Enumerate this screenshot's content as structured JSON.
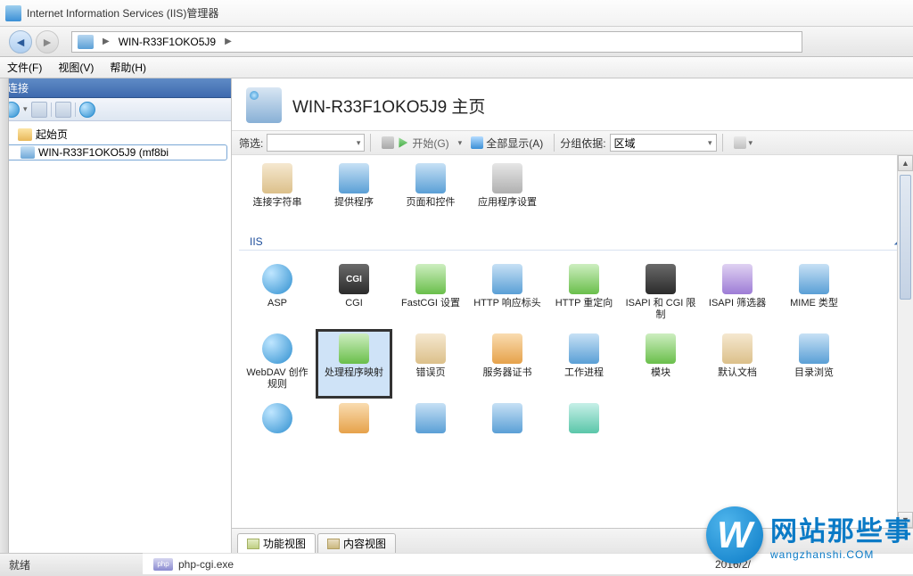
{
  "titlebar": {
    "title": "Internet Information Services (IIS)管理器"
  },
  "breadcrumb": {
    "server": "WIN-R33F1OKO5J9"
  },
  "menu": {
    "file": "文件(F)",
    "view": "视图(V)",
    "help": "帮助(H)"
  },
  "leftpanel": {
    "header": "连接",
    "items": [
      {
        "label": "起始页",
        "icon": "home"
      },
      {
        "label": "WIN-R33F1OKO5J9 (mf8bi",
        "icon": "server",
        "selected": true
      }
    ]
  },
  "content": {
    "title": "WIN-R33F1OKO5J9 主页",
    "filter": {
      "label": "筛选:",
      "value": "",
      "go": "开始(G)",
      "showAll": "全部显示(A)",
      "groupByLabel": "分组依据:",
      "groupByValue": "区域"
    },
    "groupTop": {
      "items": [
        {
          "name": "connection-strings",
          "label": "连接字符串",
          "cls": "c-tan"
        },
        {
          "name": "providers",
          "label": "提供程序",
          "cls": "c-blue"
        },
        {
          "name": "pages-controls",
          "label": "页面和控件",
          "cls": "c-blue"
        },
        {
          "name": "app-settings",
          "label": "应用程序设置",
          "cls": "c-gray"
        }
      ]
    },
    "groupIIS": {
      "header": "IIS",
      "items": [
        {
          "name": "asp",
          "label": "ASP",
          "cls": "c-globe"
        },
        {
          "name": "cgi",
          "label": "CGI",
          "cls": "c-dark cgi-txt",
          "text": "CGI"
        },
        {
          "name": "fastcgi",
          "label": "FastCGI 设置",
          "cls": "c-green"
        },
        {
          "name": "http-response-headers",
          "label": "HTTP 响应标头",
          "cls": "c-blue"
        },
        {
          "name": "http-redirect",
          "label": "HTTP 重定向",
          "cls": "c-green"
        },
        {
          "name": "isapi-cgi-restrictions",
          "label": "ISAPI 和 CGI 限制",
          "cls": "c-dark"
        },
        {
          "name": "isapi-filters",
          "label": "ISAPI 筛选器",
          "cls": "c-purple"
        },
        {
          "name": "mime-types",
          "label": "MIME 类型",
          "cls": "c-blue"
        },
        {
          "name": "webdav-authoring",
          "label": "WebDAV 创作规则",
          "cls": "c-globe"
        },
        {
          "name": "handler-mappings",
          "label": "处理程序映射",
          "cls": "c-green",
          "selected": true
        },
        {
          "name": "error-pages",
          "label": "错误页",
          "cls": "c-tan"
        },
        {
          "name": "server-certificates",
          "label": "服务器证书",
          "cls": "c-orange"
        },
        {
          "name": "worker-processes",
          "label": "工作进程",
          "cls": "c-blue"
        },
        {
          "name": "modules",
          "label": "模块",
          "cls": "c-green"
        },
        {
          "name": "default-document",
          "label": "默认文档",
          "cls": "c-tan"
        },
        {
          "name": "directory-browsing",
          "label": "目录浏览",
          "cls": "c-blue"
        }
      ],
      "extra": [
        {
          "name": "feature-extra-1",
          "cls": "c-globe"
        },
        {
          "name": "feature-extra-2",
          "cls": "c-orange"
        },
        {
          "name": "feature-extra-3",
          "cls": "c-blue"
        },
        {
          "name": "feature-extra-4",
          "cls": "c-blue"
        },
        {
          "name": "feature-extra-5",
          "cls": "c-teal"
        }
      ]
    },
    "viewtabs": {
      "features": "功能视图",
      "content": "内容视图"
    }
  },
  "statusbar": {
    "text": "就绪"
  },
  "bgfile": {
    "name": "php-cgi.exe",
    "date": "2016/2/",
    "iconText": "php"
  },
  "watermark": {
    "letter": "W",
    "big": "网站那些事",
    "small": "wangzhanshi.COM"
  }
}
